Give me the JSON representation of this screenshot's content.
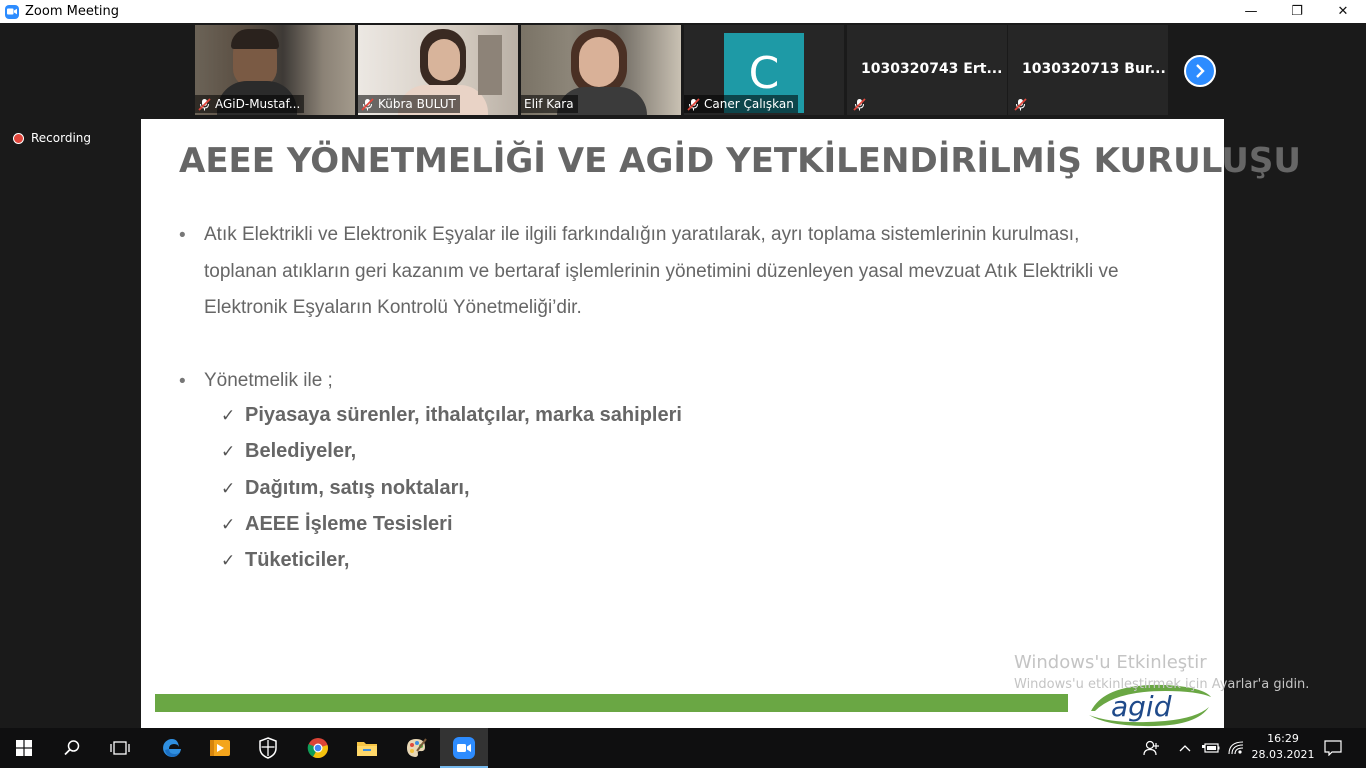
{
  "window": {
    "title": "Zoom Meeting",
    "minimize": "—",
    "maximize": "❐",
    "close": "✕"
  },
  "participants": [
    {
      "name": "AGiD-Mustaf..."
    },
    {
      "name": "Kübra BULUT"
    },
    {
      "name": "Elif Kara"
    },
    {
      "name": "Caner Çalışkan",
      "initial": "C"
    },
    {
      "name": "1030320743 Ert..."
    },
    {
      "name": "1030320713 Bur..."
    }
  ],
  "recording": {
    "label": "Recording"
  },
  "slide": {
    "title": "AEEE YÖNETMELİĞİ VE AGİD YETKİLENDİRİLMİŞ KURULUŞU",
    "bullets": [
      {
        "lines": [
          "Atık Elektrikli ve Elektronik Eşyalar ile ilgili farkındalığın yaratılarak, ayrı toplama sistemlerinin kurulması,",
          "toplanan atıkların geri kazanım ve bertaraf işlemlerinin yönetimini düzenleyen yasal mevzuat Atık Elektrikli ve",
          "Elektronik Eşyaların Kontrolü Yönetmeliği’dir."
        ]
      },
      {
        "lines": [
          "Yönetmelik ile ;"
        ]
      }
    ],
    "checklist": [
      "Piyasaya sürenler, ithalatçılar, marka sahipleri",
      "Belediyeler,",
      "Dağıtım, satış noktaları,",
      "AEEE İşleme Tesisleri",
      "Tüketiciler,"
    ],
    "logo_text": "agid",
    "colors": {
      "bar": "#6aa744",
      "title": "#666666"
    }
  },
  "watermark": {
    "line1": "Windows'u Etkinleştir",
    "line2": "Windows'u etkinleştirmek için Ayarlar'a gidin."
  },
  "taskbar": {
    "time": "16:29",
    "date": "28.03.2021"
  }
}
